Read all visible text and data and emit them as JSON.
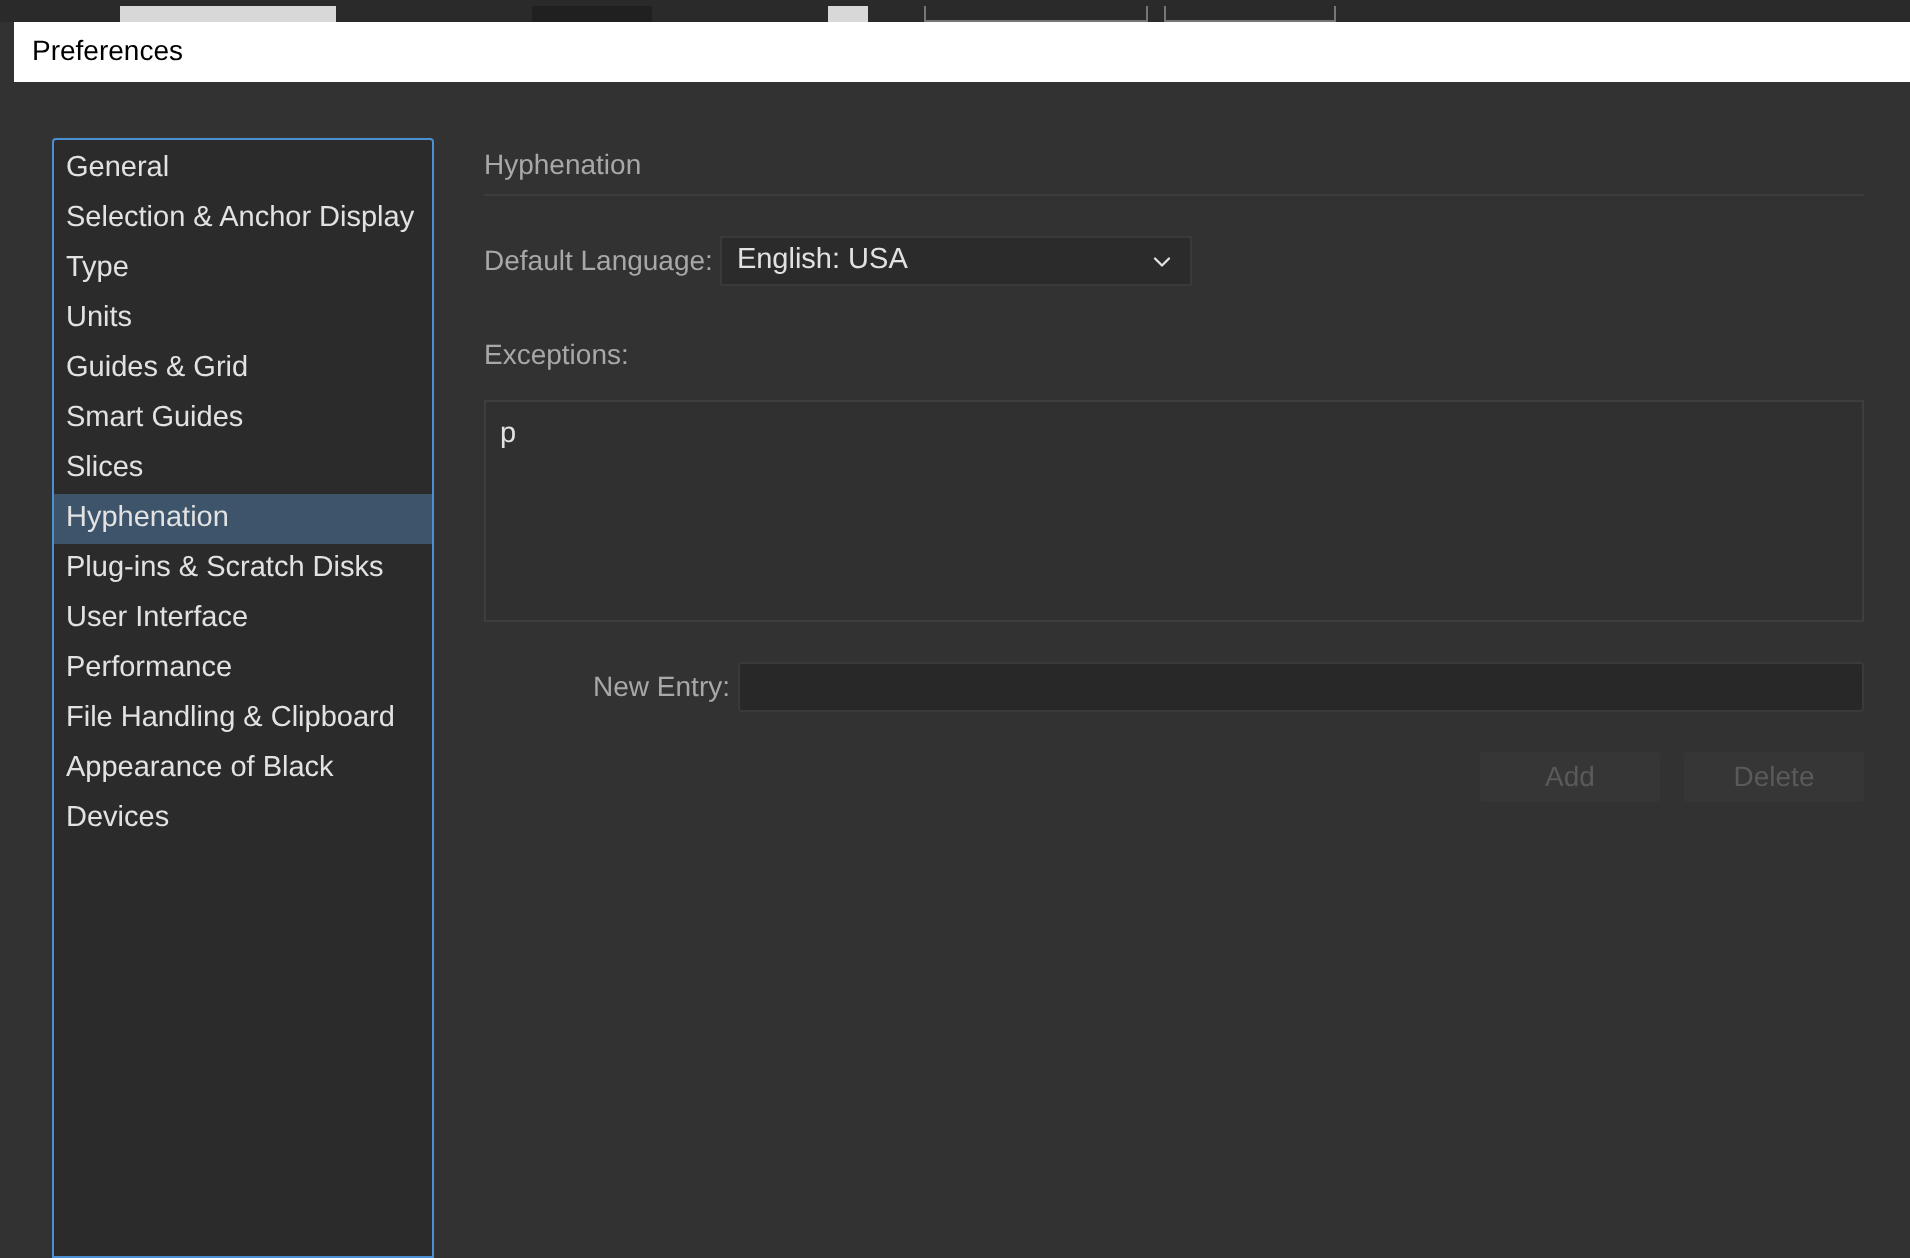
{
  "window": {
    "title": "Preferences"
  },
  "sidebar": {
    "items": [
      {
        "label": "General",
        "selected": false
      },
      {
        "label": "Selection & Anchor Display",
        "selected": false
      },
      {
        "label": "Type",
        "selected": false
      },
      {
        "label": "Units",
        "selected": false
      },
      {
        "label": "Guides & Grid",
        "selected": false
      },
      {
        "label": "Smart Guides",
        "selected": false
      },
      {
        "label": "Slices",
        "selected": false
      },
      {
        "label": "Hyphenation",
        "selected": true
      },
      {
        "label": "Plug-ins & Scratch Disks",
        "selected": false
      },
      {
        "label": "User Interface",
        "selected": false
      },
      {
        "label": "Performance",
        "selected": false
      },
      {
        "label": "File Handling & Clipboard",
        "selected": false
      },
      {
        "label": "Appearance of Black",
        "selected": false
      },
      {
        "label": "Devices",
        "selected": false
      }
    ]
  },
  "panel": {
    "heading": "Hyphenation",
    "default_language": {
      "label": "Default Language:",
      "value": "English: USA"
    },
    "exceptions": {
      "label": "Exceptions:",
      "value": "p"
    },
    "new_entry": {
      "label": "New Entry:"
    },
    "buttons": [
      {
        "label": "Add",
        "disabled": true
      },
      {
        "label": "Delete",
        "disabled": true
      }
    ]
  }
}
